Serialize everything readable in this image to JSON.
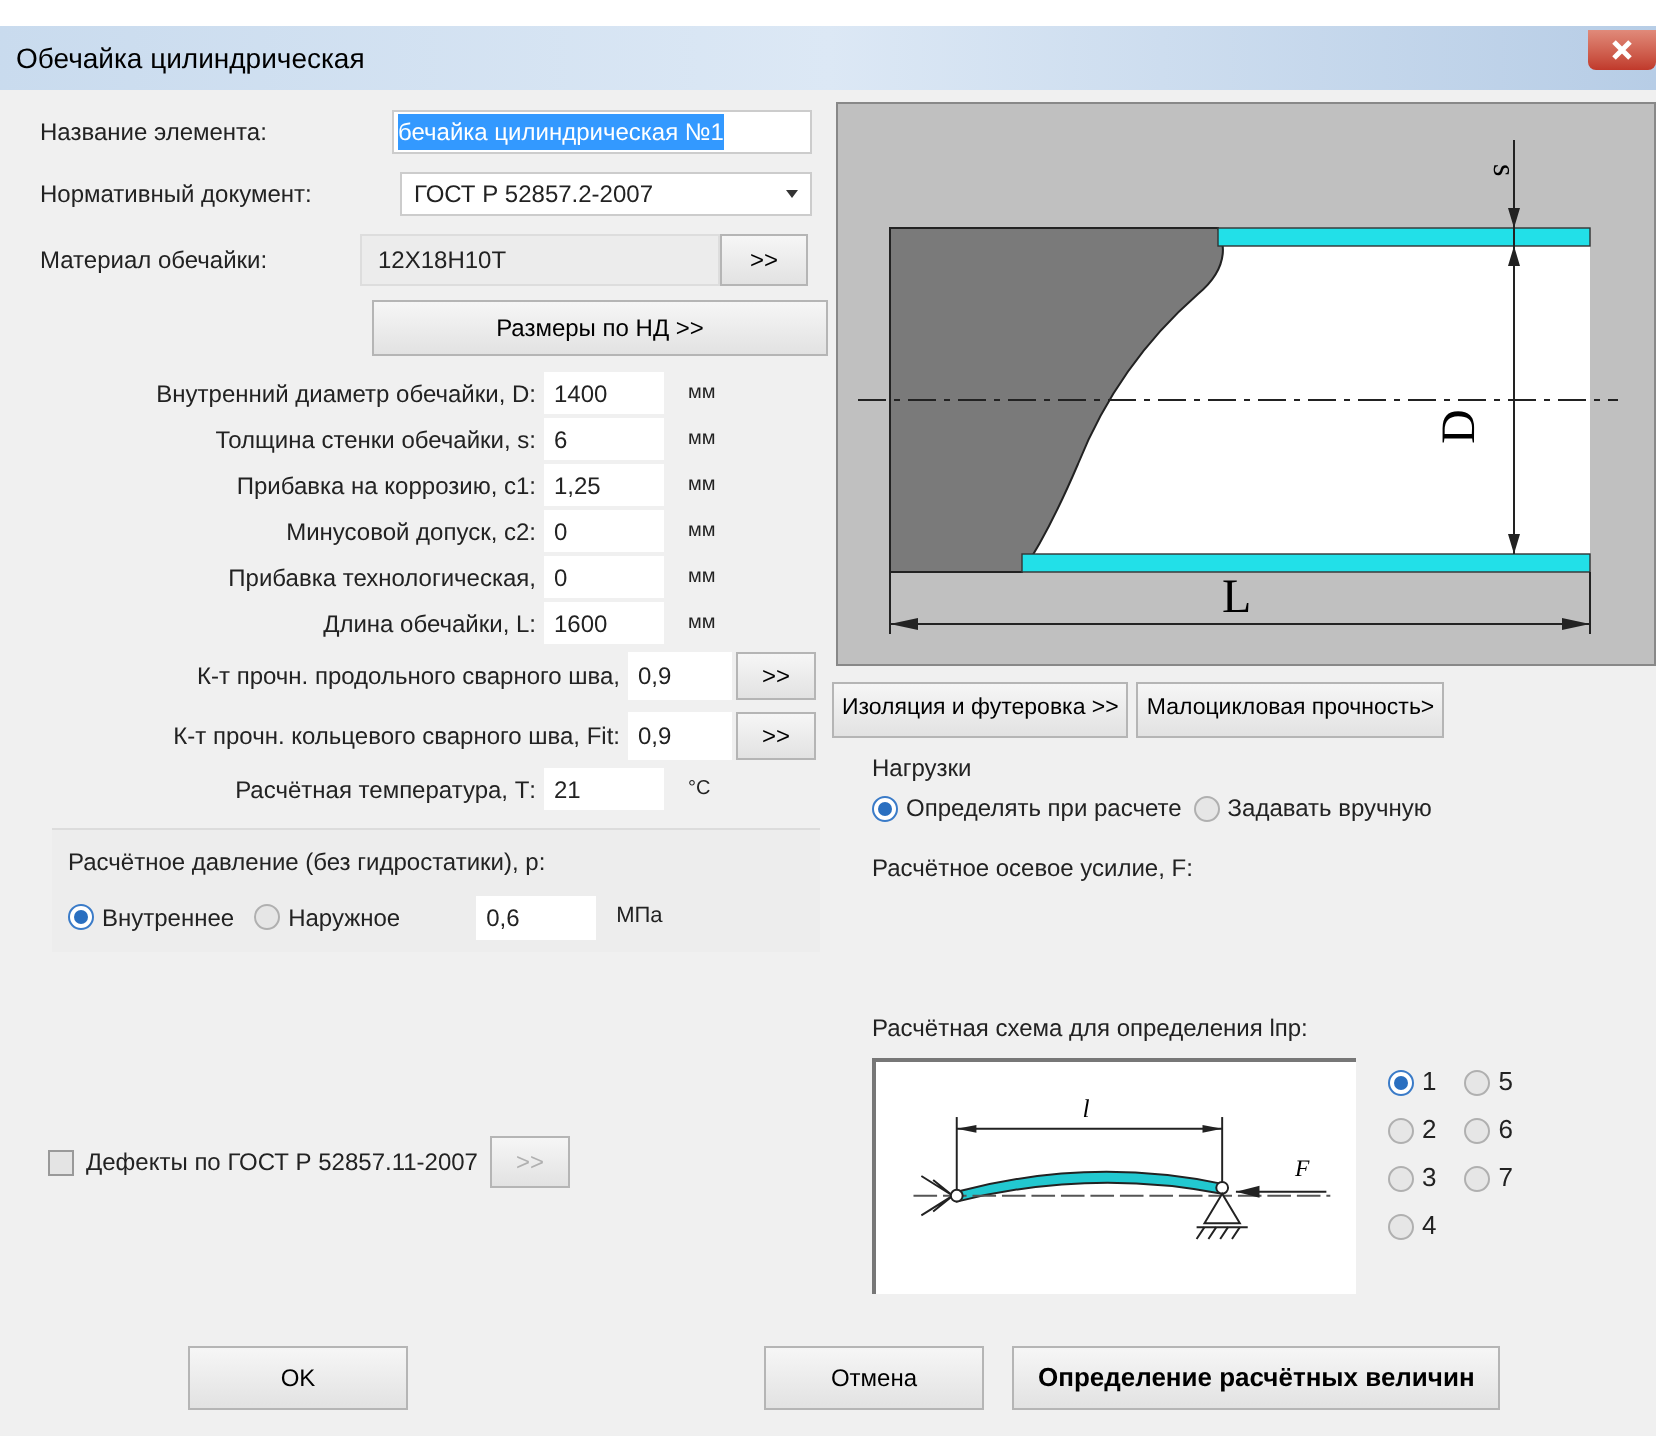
{
  "window": {
    "title": "Обечайка цилиндрическая"
  },
  "element_name": {
    "label": "Название элемента:",
    "value": "бечайка цилиндрическая №1",
    "text_selected": true
  },
  "normative_document": {
    "label": "Нормативный документ:",
    "value": "ГОСТ Р 52857.2-2007"
  },
  "material": {
    "label": "Материал обечайки:",
    "value": "12Х18Н10Т",
    "button": ">>"
  },
  "sizes_button": "Размеры по НД >>",
  "params": [
    {
      "kind": "unit",
      "label": "Внутренний диаметр обечайки, D:",
      "value": "1400",
      "unit": "мм"
    },
    {
      "kind": "unit",
      "label": "Толщина стенки обечайки, s:",
      "value": "6",
      "unit": "мм"
    },
    {
      "kind": "unit",
      "label": "Прибавка на коррозию, с1:",
      "value": "1,25",
      "unit": "мм"
    },
    {
      "kind": "unit",
      "label": "Минусовой допуск, с2:",
      "value": "0",
      "unit": "мм"
    },
    {
      "kind": "unit",
      "label": "Прибавка технологическая,",
      "value": "0",
      "unit": "мм"
    },
    {
      "kind": "unit",
      "label": "Длина обечайки, L:",
      "value": "1600",
      "unit": "мм"
    },
    {
      "kind": "button",
      "label": "К-т прочн. продольного сварного шва,",
      "value": "0,9",
      "button": ">>"
    },
    {
      "kind": "button",
      "label": "К-т прочн. кольцевого сварного шва, Fit:",
      "value": "0,9",
      "button": ">>"
    },
    {
      "kind": "unit",
      "label": "Расчётная температура, Т:",
      "value": "21",
      "unit": "°С"
    }
  ],
  "pressure": {
    "label": "Расчётное давление (без гидростатики), р:",
    "options": [
      {
        "label": "Внутреннее",
        "selected": true
      },
      {
        "label": "Наружное",
        "selected": false
      }
    ],
    "value": "0,6",
    "unit": "МПа"
  },
  "defects": {
    "label": "Дефекты по ГОСТ Р 52857.11-2007",
    "checked": false,
    "button": ">>",
    "button_disabled": true
  },
  "footer_buttons": [
    {
      "label": "OK",
      "bold": false
    },
    {
      "label": "Отмена",
      "bold": false
    },
    {
      "label": "Определение расчётных величин",
      "bold": true
    }
  ],
  "diagram": {
    "s_label": "s",
    "d_label": "D",
    "l_label": "L"
  },
  "side_buttons": [
    "Изоляция и футеровка >>",
    "Малоцикловая прочность>"
  ],
  "loads": {
    "title": "Нагрузки",
    "options": [
      {
        "label": "Определять при расчете",
        "selected": true
      },
      {
        "label": "Задавать вручную",
        "selected": false
      }
    ]
  },
  "axial_force_label": "Расчётное осевое усилие, F:",
  "scheme": {
    "label": "Расчётная схема для определения lпр:",
    "l_label": "l",
    "f_label": "F",
    "options": [
      {
        "label": "1",
        "selected": true
      },
      {
        "label": "2",
        "selected": false
      },
      {
        "label": "3",
        "selected": false
      },
      {
        "label": "4",
        "selected": false
      },
      {
        "label": "5",
        "selected": false
      },
      {
        "label": "6",
        "selected": false
      },
      {
        "label": "7",
        "selected": false
      }
    ]
  }
}
